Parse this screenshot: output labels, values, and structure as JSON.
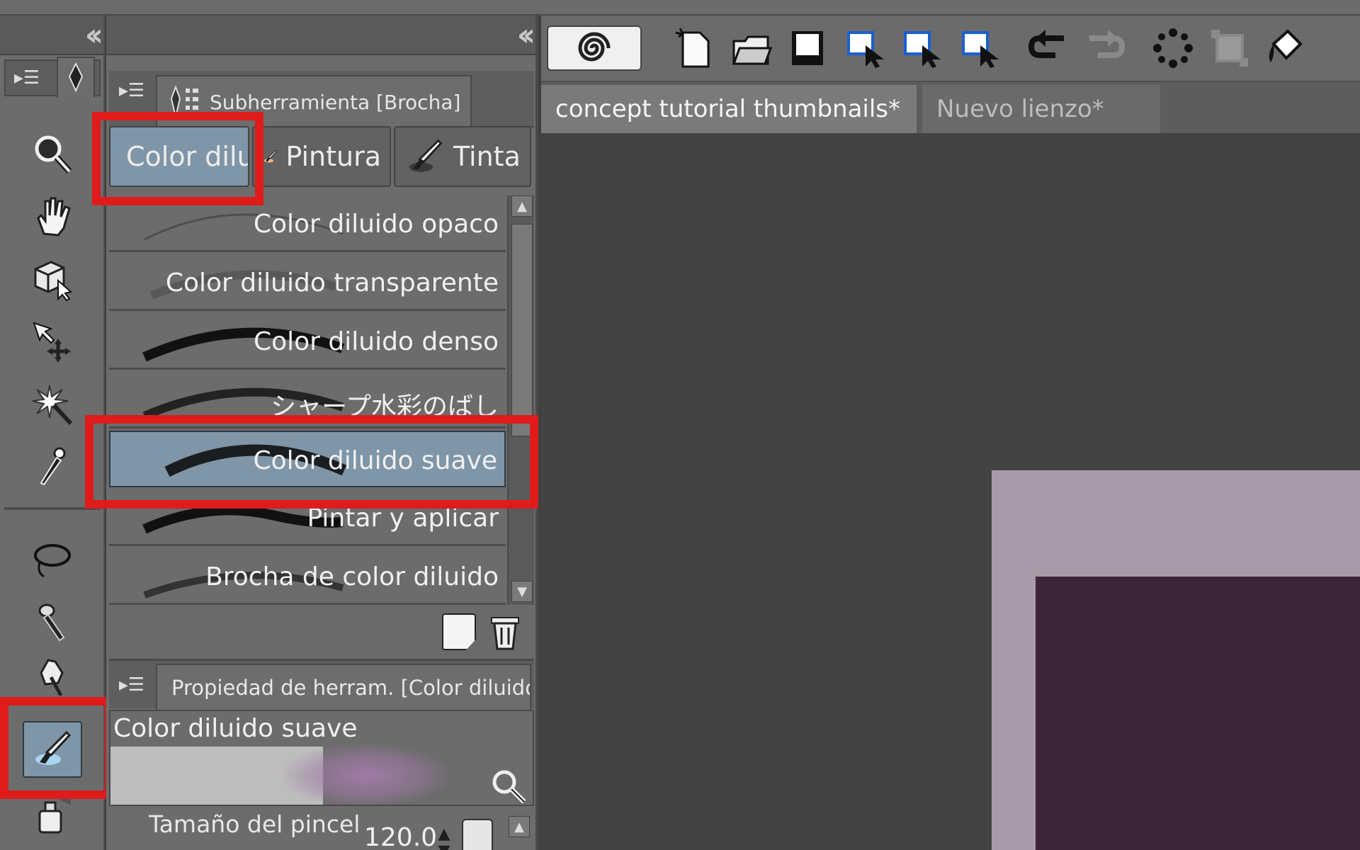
{
  "subtool_panel": {
    "title": "Subherramienta [Brocha]",
    "groups": [
      {
        "label": "Color diluido"
      },
      {
        "label": "Pintura"
      },
      {
        "label": "Tinta"
      }
    ],
    "brushes": [
      {
        "label": "Color diluido opaco",
        "selected": false
      },
      {
        "label": "Color diluido transparente",
        "selected": false
      },
      {
        "label": "Color diluido denso",
        "selected": false
      },
      {
        "label": "シャープ水彩のばし",
        "selected": false
      },
      {
        "label": "Color diluido suave",
        "selected": true
      },
      {
        "label": "Pintar y aplicar",
        "selected": false
      },
      {
        "label": "Brocha de color diluido",
        "selected": false
      }
    ]
  },
  "tool_property": {
    "title": "Propiedad de herram. [Color diluido suave]",
    "preview_name": "Color diluido suave",
    "brush_size_label": "Tamaño del pincel",
    "brush_size_value": "120.0"
  },
  "document_tabs": [
    {
      "label": "concept tutorial thumbnails*",
      "active": true
    },
    {
      "label": "Nuevo lienzo*",
      "active": false
    }
  ],
  "colors": {
    "highlight": "#e01b1b",
    "selection": "#7f96a8",
    "panel": "#6c6c6c",
    "canvas_bg": "#434343",
    "page_outer": "#a89ba9",
    "page_inner": "#3d2539"
  }
}
